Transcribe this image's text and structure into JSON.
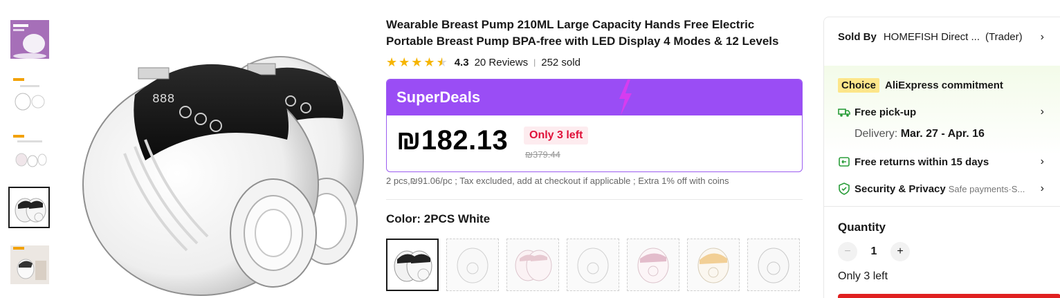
{
  "thumbnails": [
    {
      "name": "thumb-product-promo"
    },
    {
      "name": "thumb-product-structure"
    },
    {
      "name": "thumb-product-parts"
    },
    {
      "name": "thumb-product-white-2pcs",
      "active": true
    },
    {
      "name": "thumb-product-box"
    }
  ],
  "product": {
    "title": "Wearable Breast Pump 210ML Large Capacity Hands Free Electric Portable Breast Pump BPA-free with LED Display 4 Modes & 12 Levels",
    "rating": 4.3,
    "rating_text": "4.3",
    "reviews": "20 Reviews",
    "sold": "252 sold"
  },
  "deal": {
    "banner": "SuperDeals",
    "price": "₪182.13",
    "stock_badge": "Only 3 left",
    "original_price": "₪379.44",
    "tax_note": "2 pcs,₪91.06/pc ; Tax excluded, add at checkout if applicable ; Extra 1% off with coins",
    "accent_color": "#9a4df5",
    "badge_color": "#e0123a"
  },
  "color_option": {
    "label": "Color: 2PCS White",
    "swatches": [
      "2PCS White",
      "swatch-2",
      "swatch-3",
      "swatch-4",
      "swatch-5",
      "swatch-6",
      "swatch-7"
    ],
    "selected_index": 0
  },
  "seller": {
    "label": "Sold By",
    "name": "HOMEFISH Direct ...",
    "type": "(Trader)"
  },
  "commitment": {
    "badge": "Choice",
    "text": "AliExpress commitment",
    "pickup": "Free pick-up",
    "delivery_label": "Delivery:",
    "delivery_dates": "Mar. 27 - Apr. 16",
    "returns": "Free returns within 15 days",
    "security": "Security & Privacy",
    "security_sub": "Safe payments·S...",
    "accent_color": "#2a9d3a"
  },
  "quantity": {
    "label": "Quantity",
    "value": "1",
    "minus": "−",
    "plus": "+",
    "stock_note": "Only 3 left"
  }
}
